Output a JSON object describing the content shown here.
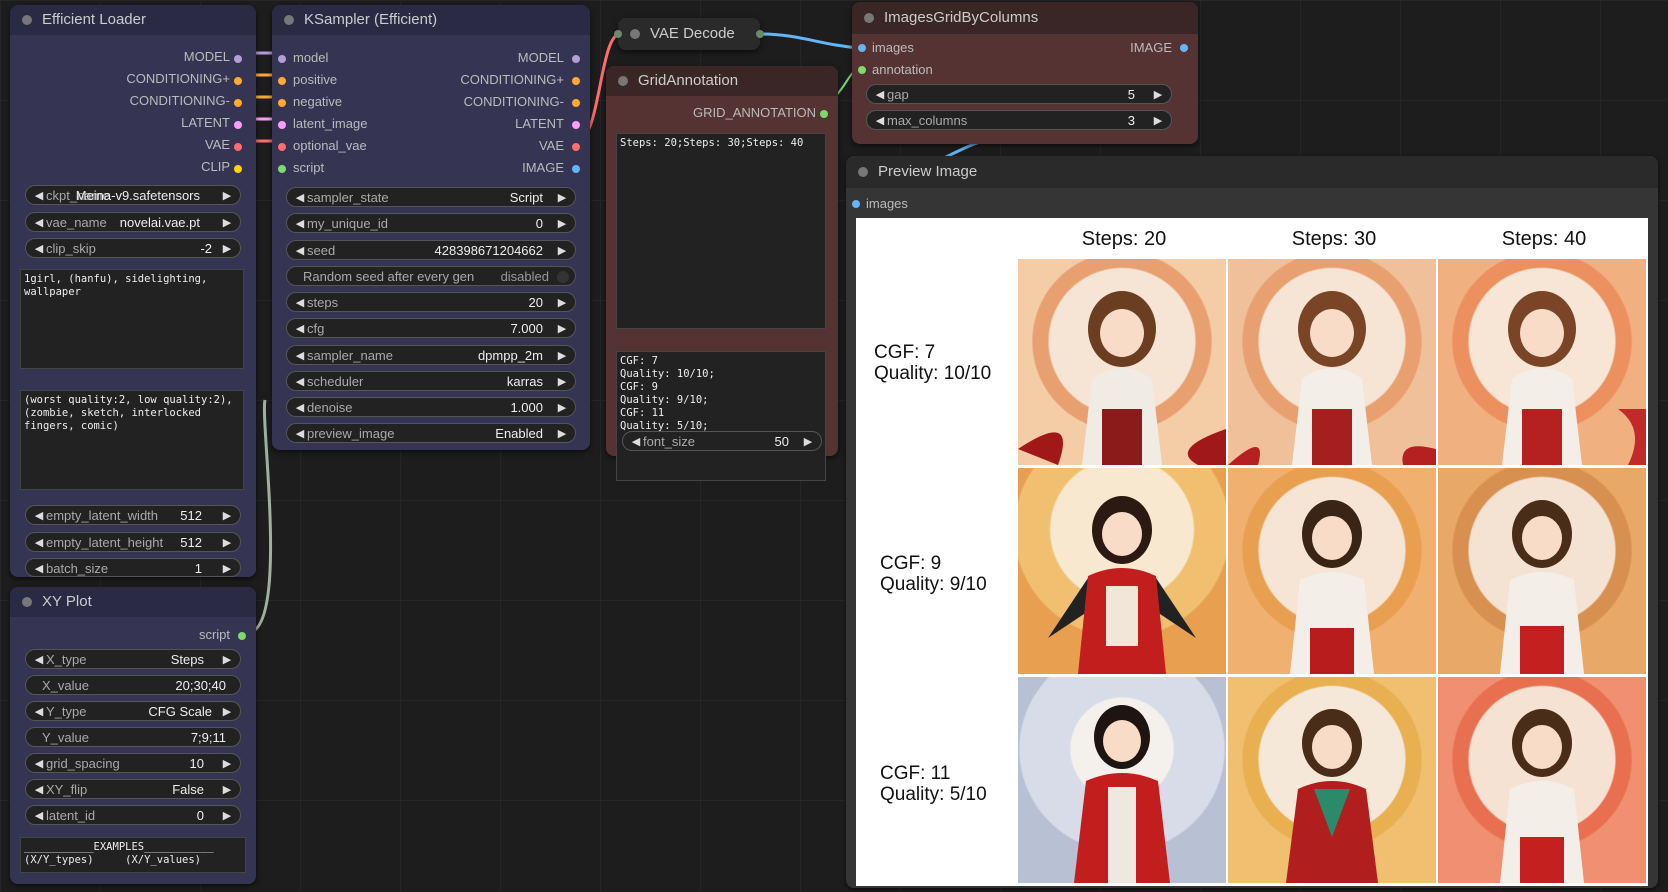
{
  "colors": {
    "model": "#b39ddb",
    "conditioning": "#ffa931",
    "latent": "#ff9cf9",
    "vae": "#ff6e6e",
    "clip": "#ffd500",
    "script": "#7cdc6b",
    "image": "#64b5f6",
    "annotation": "#7cdc6b"
  },
  "efficient_loader": {
    "title": "Efficient Loader",
    "outputs": [
      "MODEL",
      "CONDITIONING+",
      "CONDITIONING-",
      "LATENT",
      "VAE",
      "CLIP"
    ],
    "widgets": [
      {
        "label": "ckpt_name",
        "value": "Meina-v9.safetensors"
      },
      {
        "label": "vae_name",
        "value": "novelai.vae.pt"
      },
      {
        "label": "clip_skip",
        "value": "-2"
      }
    ],
    "positive_text": "1girl, (hanfu), sidelighting,\nwallpaper",
    "negative_text": "(worst quality:2, low quality:2),\n(zombie, sketch, interlocked\nfingers, comic)",
    "widgets2": [
      {
        "label": "empty_latent_width",
        "value": "512"
      },
      {
        "label": "empty_latent_height",
        "value": "512"
      },
      {
        "label": "batch_size",
        "value": "1"
      }
    ]
  },
  "ksampler": {
    "title": "KSampler (Efficient)",
    "inputs": [
      "model",
      "positive",
      "negative",
      "latent_image",
      "optional_vae",
      "script"
    ],
    "outputs": [
      "MODEL",
      "CONDITIONING+",
      "CONDITIONING-",
      "LATENT",
      "VAE",
      "IMAGE"
    ],
    "widgets": [
      {
        "label": "sampler_state",
        "value": "Script"
      },
      {
        "label": "my_unique_id",
        "value": "0"
      },
      {
        "label": "seed",
        "value": "428398671204662"
      },
      {
        "label": "Random seed after every gen",
        "value": "disabled"
      },
      {
        "label": "steps",
        "value": "20"
      },
      {
        "label": "cfg",
        "value": "7.000"
      },
      {
        "label": "sampler_name",
        "value": "dpmpp_2m"
      },
      {
        "label": "scheduler",
        "value": "karras"
      },
      {
        "label": "denoise",
        "value": "1.000"
      },
      {
        "label": "preview_image",
        "value": "Enabled"
      }
    ]
  },
  "xy_plot": {
    "title": "XY Plot",
    "output": "script",
    "widgets": [
      {
        "label": "X_type",
        "value": "Steps"
      },
      {
        "label": "X_value",
        "value": "20;30;40"
      },
      {
        "label": "Y_type",
        "value": "CFG Scale"
      },
      {
        "label": "Y_value",
        "value": "7;9;11"
      },
      {
        "label": "grid_spacing",
        "value": "10"
      },
      {
        "label": "XY_flip",
        "value": "False"
      },
      {
        "label": "latent_id",
        "value": "0"
      }
    ],
    "examples_text": "___________EXAMPLES___________\n(X/Y_types)     (X/Y_values)"
  },
  "vae_decode": {
    "title": "VAE Decode"
  },
  "grid_annotation": {
    "title": "GridAnnotation",
    "output": "GRID_ANNOTATION",
    "column_text": "Steps: 20;Steps: 30;Steps: 40",
    "row_text": "CGF: 7\nQuality: 10/10;\nCGF: 9\nQuality: 9/10;\nCGF: 11\nQuality: 5/10;",
    "font_size_label": "font_size",
    "font_size_value": "50"
  },
  "images_grid": {
    "title": "ImagesGridByColumns",
    "inputs": [
      "images",
      "annotation"
    ],
    "output": "IMAGE",
    "widgets": [
      {
        "label": "gap",
        "value": "5"
      },
      {
        "label": "max_columns",
        "value": "3"
      }
    ]
  },
  "preview_image": {
    "title": "Preview Image",
    "input": "images",
    "column_headers": [
      "Steps: 20",
      "Steps: 30",
      "Steps: 40"
    ],
    "row_headers": [
      {
        "line1": "CGF: 7",
        "line2": "Quality: 10/10"
      },
      {
        "line1": "CGF: 9",
        "line2": "Quality: 9/10"
      },
      {
        "line1": "CGF: 11",
        "line2": "Quality: 5/10"
      }
    ]
  }
}
